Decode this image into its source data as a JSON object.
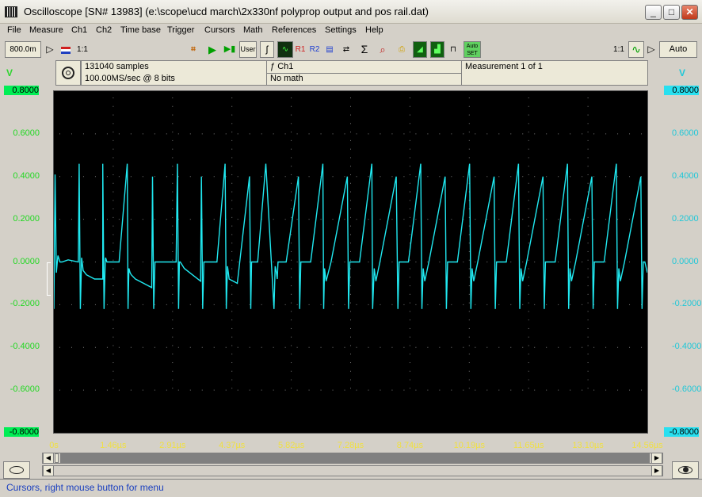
{
  "window": {
    "title": "Oscilloscope  [SN# 13983]  (e:\\scope\\ucd march\\2x330nf polyprop output and pos rail.dat)"
  },
  "titlebar_buttons": {
    "minimize": "_",
    "maximize": "□",
    "close": "✕"
  },
  "menu": [
    "File",
    "Measure",
    "Ch1",
    "Ch2",
    "Time base",
    "Trigger",
    "Cursors",
    "Math",
    "References",
    "Settings",
    "Help"
  ],
  "toolbar": {
    "range": "800.0m",
    "ratio_left": "1:1",
    "user": "User",
    "r1": "R1",
    "r2": "R2",
    "auto_set": "Auto SET",
    "ratio_right": "1:1",
    "auto": "Auto"
  },
  "info": {
    "samples": "131040 samples",
    "rate": "100.00MS/sec @ 8 bits",
    "channel": "Ch1",
    "math": "No math",
    "measurement": "Measurement 1 of 1"
  },
  "axis": {
    "unit_left": "V",
    "unit_right": "V",
    "y_ticks": [
      "0.8000",
      "0.6000",
      "0.4000",
      "0.2000",
      "0.0000",
      "-0.2000",
      "-0.4000",
      "-0.6000",
      "-0.8000"
    ],
    "x_ticks": [
      "0s",
      "1.46µs",
      "2.91µs",
      "4.37µs",
      "5.82µs",
      "7.28µs",
      "8.74µs",
      "10.19µs",
      "11.65µs",
      "13.10µs",
      "14.56µs"
    ]
  },
  "colors": {
    "trace": "#20e8f0",
    "left_scale": "#22d822",
    "right_scale": "#20c8d8",
    "time_axis": "#f0e040",
    "status": "#1a3fbf"
  },
  "status": {
    "text": "Cursors, right mouse button for menu"
  },
  "chart_data": {
    "type": "line",
    "xlabel": "",
    "ylabel": "V",
    "xlim": [
      0,
      14.56
    ],
    "ylim": [
      -0.8,
      0.8
    ],
    "grid": true,
    "series": [
      {
        "x": [
          0.0,
          0.03,
          0.06,
          0.1,
          0.15,
          0.2,
          0.35,
          0.6,
          0.62,
          0.65,
          0.68,
          0.72,
          0.8,
          1.0,
          1.2,
          1.2,
          1.23,
          1.26,
          1.27,
          1.3,
          1.4,
          1.6,
          1.8,
          1.82,
          1.84,
          1.87,
          1.9,
          1.95,
          2.0,
          2.2,
          2.4,
          2.42,
          2.45,
          2.48,
          2.52,
          2.6,
          2.8,
          3.0,
          3.03,
          3.06,
          3.08,
          3.1,
          3.2,
          3.4,
          3.6,
          3.62,
          3.65,
          3.68,
          3.72,
          3.8,
          4.0,
          4.2,
          4.23,
          4.26,
          4.28,
          4.3,
          4.5,
          4.8,
          4.83,
          4.85,
          4.88,
          4.92,
          5.0,
          5.2,
          5.4,
          5.43,
          5.46,
          5.48,
          5.5,
          5.7,
          6.0,
          6.03,
          6.06,
          6.1,
          6.15,
          6.3,
          6.6,
          6.62,
          6.64,
          6.66,
          6.68,
          6.8,
          7.2,
          7.23,
          7.26,
          7.3,
          7.35,
          7.5,
          7.8,
          7.82,
          7.86,
          7.88,
          7.9,
          8.0,
          8.4,
          8.44,
          8.47,
          8.5,
          8.55,
          8.7,
          9.0,
          9.03,
          9.06,
          9.08,
          9.1,
          9.2,
          9.6,
          9.63,
          9.66,
          9.7,
          9.75,
          9.9,
          10.2,
          10.23,
          10.26,
          10.28,
          10.3,
          10.4,
          10.8,
          10.83,
          10.86,
          10.9,
          10.95,
          11.1,
          11.4,
          11.43,
          11.46,
          11.48,
          11.5,
          11.6,
          12.0,
          12.03,
          12.06,
          12.1,
          12.15,
          12.3,
          12.6,
          12.63,
          12.66,
          12.68,
          12.7,
          12.8,
          13.2,
          13.23,
          13.26,
          13.3,
          13.35,
          13.5,
          13.8,
          13.83,
          13.86,
          13.88,
          13.9,
          14.0,
          14.4,
          14.43,
          14.46,
          14.5,
          14.56
        ],
        "y": [
          -0.22,
          0.41,
          -0.05,
          0.03,
          0.0,
          0.0,
          0.01,
          0.0,
          0.46,
          -0.22,
          0.02,
          -0.04,
          -0.06,
          -0.08,
          -0.08,
          0.46,
          -0.22,
          0.0,
          0.02,
          0.0,
          0.0,
          0.0,
          0.46,
          -0.22,
          -0.03,
          -0.05,
          -0.06,
          -0.07,
          -0.08,
          -0.1,
          -0.12,
          0.4,
          -0.22,
          0.0,
          0.0,
          0.0,
          0.0,
          0.0,
          0.46,
          -0.22,
          0.0,
          0.0,
          -0.03,
          -0.06,
          -0.09,
          0.4,
          -0.22,
          0.0,
          0.0,
          0.0,
          0.0,
          0.46,
          -0.22,
          -0.02,
          -0.05,
          -0.08,
          -0.1,
          0.4,
          -0.22,
          0.0,
          0.0,
          0.0,
          0.0,
          0.46,
          -0.22,
          -0.02,
          -0.05,
          -0.08,
          0.0,
          0.0,
          0.4,
          -0.22,
          0.0,
          0.0,
          0.0,
          0.0,
          0.46,
          -0.22,
          -0.03,
          -0.06,
          -0.09,
          0.0,
          0.4,
          -0.22,
          0.0,
          0.0,
          0.0,
          0.0,
          0.46,
          -0.22,
          -0.03,
          -0.06,
          -0.09,
          0.0,
          0.4,
          -0.22,
          0.0,
          0.0,
          0.0,
          0.0,
          0.46,
          -0.22,
          -0.03,
          -0.06,
          -0.09,
          0.0,
          0.4,
          -0.22,
          0.0,
          0.0,
          0.0,
          0.0,
          0.46,
          -0.22,
          -0.03,
          -0.06,
          -0.09,
          0.0,
          0.4,
          -0.22,
          0.0,
          0.0,
          0.0,
          0.0,
          0.46,
          -0.22,
          -0.03,
          -0.06,
          -0.09,
          0.0,
          0.4,
          -0.22,
          0.0,
          0.0,
          0.0,
          0.0,
          0.46,
          -0.22,
          -0.03,
          -0.06,
          -0.09,
          0.0,
          0.4,
          -0.22,
          0.0,
          0.0,
          0.0,
          0.0,
          0.46,
          -0.22,
          -0.03,
          -0.06,
          -0.09,
          0.0,
          0.4,
          -0.22,
          0.0,
          0.0,
          -0.05
        ]
      }
    ]
  }
}
